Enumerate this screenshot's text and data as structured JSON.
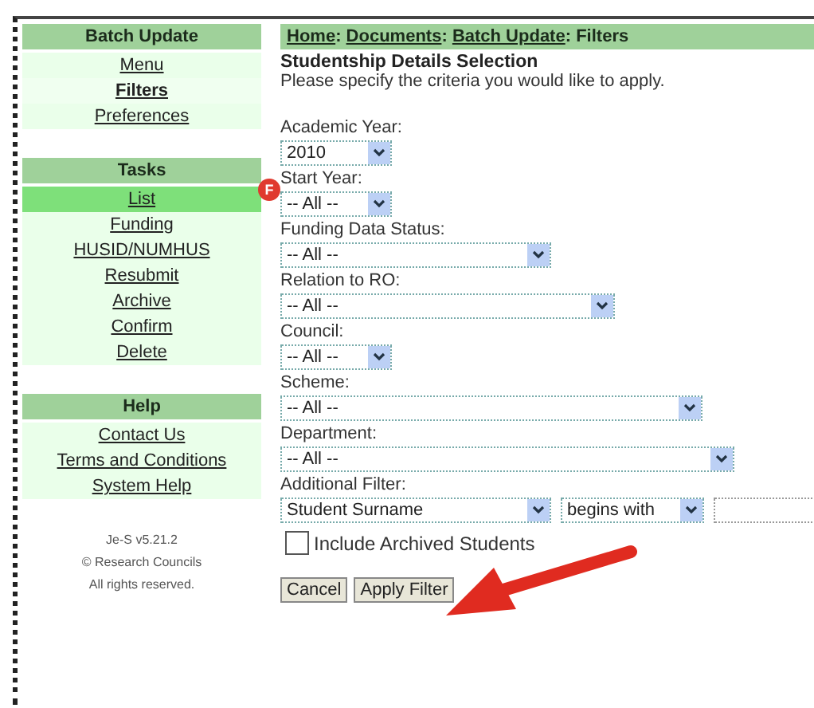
{
  "sidebar": {
    "sections": [
      {
        "title": "Batch Update",
        "items": [
          {
            "label": "Menu",
            "selected": false
          },
          {
            "label": "Filters",
            "selected": true
          },
          {
            "label": "Preferences",
            "selected": false
          }
        ]
      },
      {
        "title": "Tasks",
        "items": [
          {
            "label": "List",
            "selected": true
          },
          {
            "label": "Funding",
            "selected": false
          },
          {
            "label": "HUSID/NUMHUS",
            "selected": false
          },
          {
            "label": "Resubmit",
            "selected": false
          },
          {
            "label": "Archive",
            "selected": false
          },
          {
            "label": "Confirm",
            "selected": false
          },
          {
            "label": "Delete",
            "selected": false
          }
        ]
      },
      {
        "title": "Help",
        "items": [
          {
            "label": "Contact Us",
            "selected": false
          },
          {
            "label": "Terms and Conditions",
            "selected": false
          },
          {
            "label": "System Help",
            "selected": false
          }
        ]
      }
    ],
    "footer": [
      "Je-S v5.21.2",
      "© Research Councils",
      "All rights reserved."
    ]
  },
  "breadcrumb": [
    {
      "label": "Home",
      "link": true,
      "separator": ":"
    },
    {
      "label": "Documents",
      "link": true,
      "separator": ":"
    },
    {
      "label": "Batch Update",
      "link": true,
      "separator": ":"
    },
    {
      "label": "Filters",
      "link": false
    }
  ],
  "heading": "Studentship Details Selection",
  "intro": "Please specify the criteria you would like to apply.",
  "badge": "F",
  "fields": [
    {
      "label": "Academic Year:",
      "value": "2010"
    },
    {
      "label": "Start Year:",
      "value": "-- All --"
    },
    {
      "label": "Funding Data Status:",
      "value": "-- All --"
    },
    {
      "label": "Relation to RO:",
      "value": "-- All --"
    },
    {
      "label": "Council:",
      "value": "-- All --"
    },
    {
      "label": "Scheme:",
      "value": "-- All --"
    },
    {
      "label": "Department:",
      "value": "-- All --"
    }
  ],
  "additional_filter": {
    "label": "Additional Filter:",
    "field": "Student Surname",
    "operator": "begins with"
  },
  "include_archived": {
    "label": "Include Archived Students",
    "checked": false
  },
  "buttons": [
    "Cancel",
    "Apply Filter"
  ]
}
